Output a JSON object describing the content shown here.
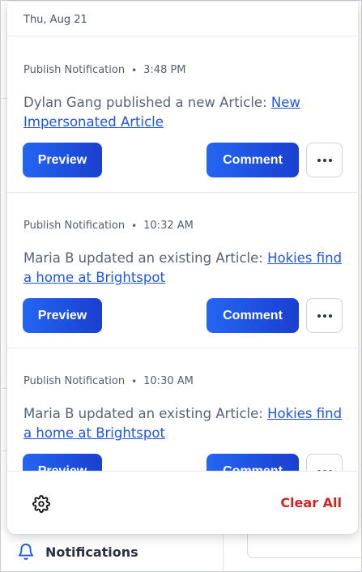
{
  "popover": {
    "date_header": "Thu, Aug 21",
    "notifications": [
      {
        "type": "Publish Notification",
        "time": "3:48 PM",
        "text": "Dylan Gang published a new Article: ",
        "link": "New Impersonated Article",
        "preview_label": "Preview",
        "comment_label": "Comment"
      },
      {
        "type": "Publish Notification",
        "time": "10:32 AM",
        "text": "Maria B updated an existing Article: ",
        "link": "Hokies find a home at Brightspot",
        "preview_label": "Preview",
        "comment_label": "Comment"
      },
      {
        "type": "Publish Notification",
        "time": "10:30 AM",
        "text": "Maria B updated an existing Article: ",
        "link": "Hokies find a home at Brightspot",
        "preview_label": "Preview",
        "comment_label": "Comment"
      }
    ],
    "footer": {
      "settings_icon": "gear-icon",
      "clear_all_label": "Clear All"
    }
  },
  "sidebar": {
    "notifications_label": "Notifications",
    "notifications_icon": "bell-icon"
  },
  "colors": {
    "accent": "#1f56e0",
    "danger": "#d42323",
    "text": "#5a6273"
  }
}
